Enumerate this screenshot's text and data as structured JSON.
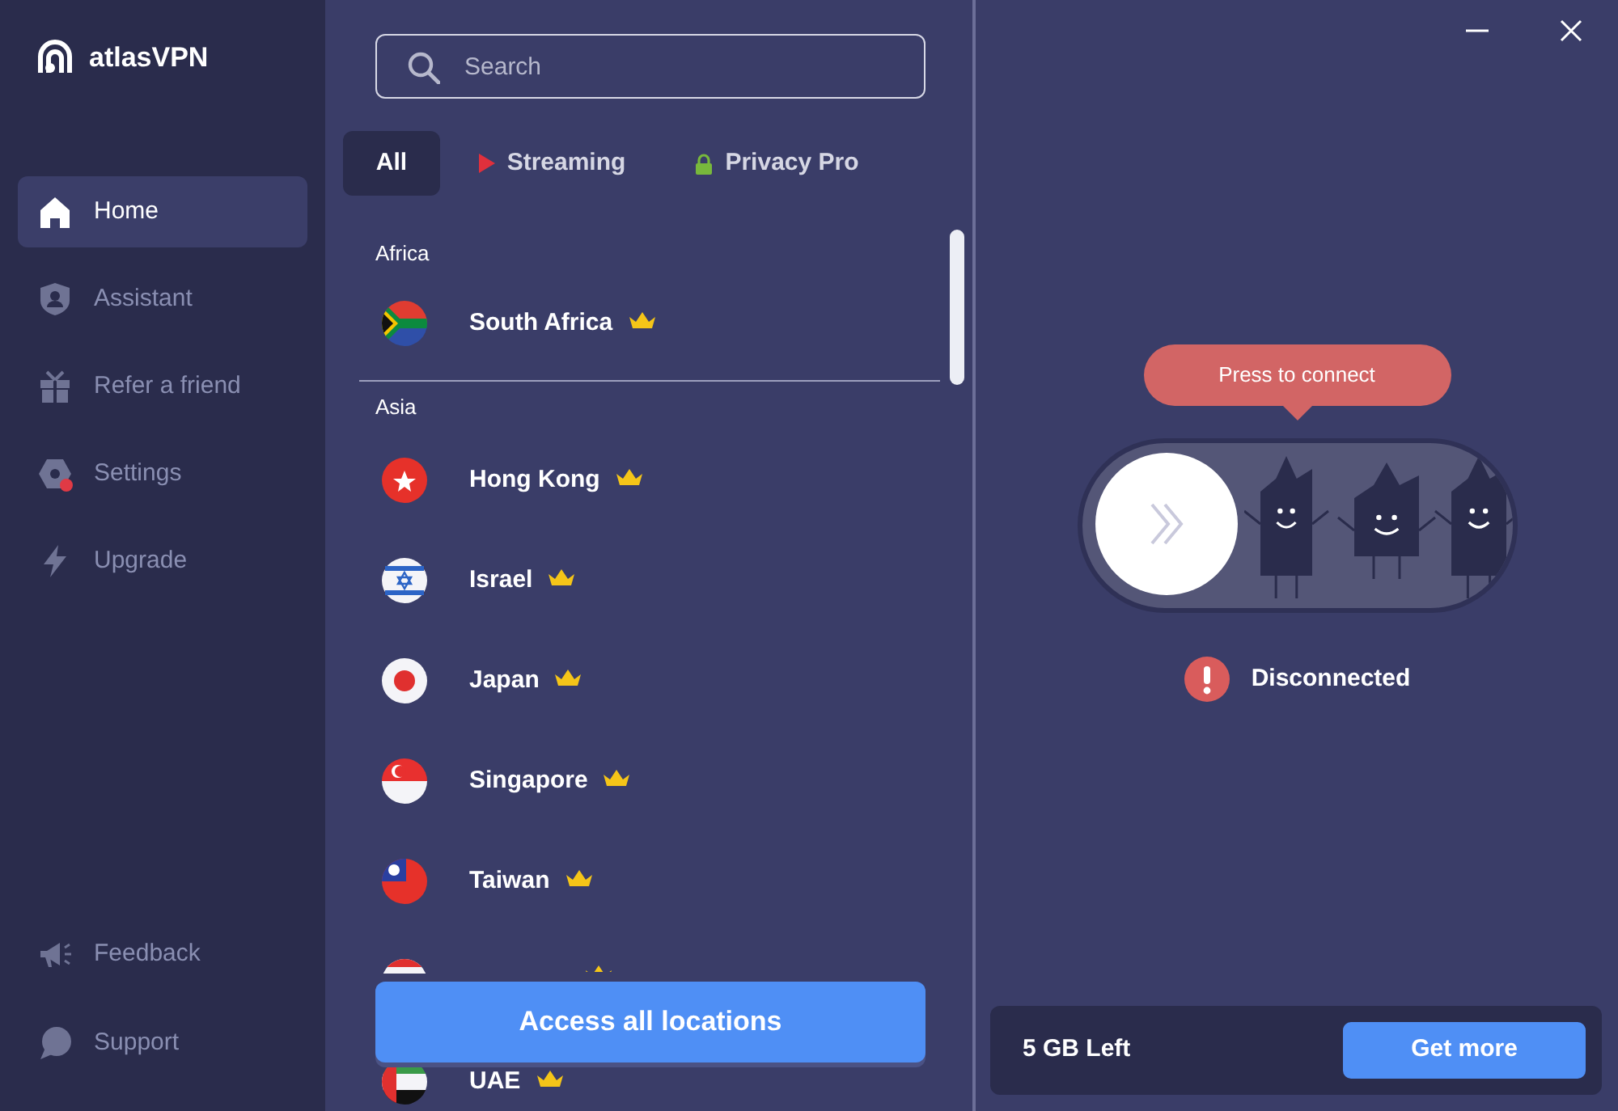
{
  "app": {
    "brand": "atlasVPN"
  },
  "sidebar": {
    "items": [
      {
        "label": "Home",
        "selected": true
      },
      {
        "label": "Assistant",
        "selected": false
      },
      {
        "label": "Refer a friend",
        "selected": false
      },
      {
        "label": "Settings",
        "selected": false,
        "alert": true
      },
      {
        "label": "Upgrade",
        "selected": false
      }
    ],
    "footer_items": [
      {
        "label": "Feedback"
      },
      {
        "label": "Support"
      }
    ]
  },
  "search": {
    "placeholder": "Search"
  },
  "tabs": [
    {
      "label": "All",
      "selected": true
    },
    {
      "label": "Streaming",
      "selected": false
    },
    {
      "label": "Privacy Pro",
      "selected": false
    }
  ],
  "regions": [
    {
      "name": "Africa",
      "locations": [
        {
          "name": "South Africa",
          "premium": true
        }
      ]
    },
    {
      "name": "Asia",
      "locations": [
        {
          "name": "Hong Kong",
          "premium": true
        },
        {
          "name": "Israel",
          "premium": true
        },
        {
          "name": "Japan",
          "premium": true
        },
        {
          "name": "Singapore",
          "premium": true
        },
        {
          "name": "Taiwan",
          "premium": true
        },
        {
          "premium": true
        },
        {
          "name": "UAE",
          "premium": true
        }
      ]
    }
  ],
  "access_button": "Access all locations",
  "connect": {
    "tooltip": "Press to connect",
    "connected": false,
    "status": "Disconnected"
  },
  "data_card": {
    "remaining": "5 GB Left",
    "button": "Get more"
  }
}
